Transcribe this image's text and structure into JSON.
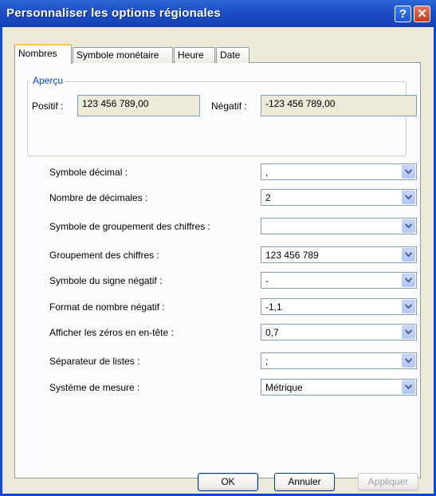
{
  "window": {
    "title": "Personnaliser les options régionales",
    "help_label": "?",
    "close_label": "✕"
  },
  "tabs": [
    {
      "label": "Nombres",
      "active": true
    },
    {
      "label": "Symbole monétaire",
      "active": false
    },
    {
      "label": "Heure",
      "active": false
    },
    {
      "label": "Date",
      "active": false
    }
  ],
  "preview": {
    "legend": "Aperçu",
    "positive_label": "Positif :",
    "positive_value": "123 456 789,00",
    "negative_label": "Négatif :",
    "negative_value": "-123 456 789,00"
  },
  "settings": [
    {
      "label": "Symbole décimal :",
      "value": ","
    },
    {
      "label": "Nombre de décimales :",
      "value": "2"
    },
    {
      "label": "Symbole de groupement des chiffres :",
      "value": ""
    },
    {
      "label": "Groupement des chiffres :",
      "value": "123 456 789"
    },
    {
      "label": "Symbole du signe négatif :",
      "value": "-"
    },
    {
      "label": "Format de nombre négatif :",
      "value": "-1,1"
    },
    {
      "label": "Afficher les zéros en en-tête :",
      "value": "0,7"
    },
    {
      "label": "Séparateur de listes :",
      "value": ";"
    },
    {
      "label": "Système de mesure :",
      "value": "Métrique"
    }
  ],
  "buttons": {
    "ok": "OK",
    "cancel": "Annuler",
    "apply": "Appliquer"
  },
  "colors": {
    "titlebar": "#1F4FC6",
    "window_bg": "#ECE9D8",
    "accent": "#0046D5"
  }
}
